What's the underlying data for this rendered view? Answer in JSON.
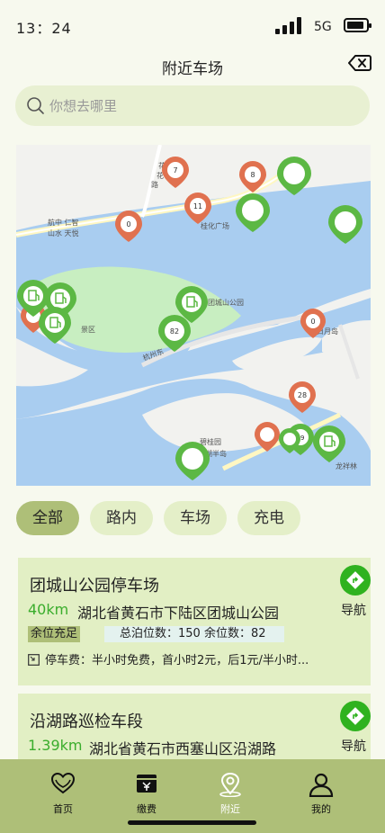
{
  "status_bar": {
    "time": "13：24",
    "network": "5G"
  },
  "header": {
    "title": "附近车场"
  },
  "search": {
    "placeholder": "你想去哪里"
  },
  "map": {
    "labels": [
      "航中 仁智",
      "山水 天悦",
      "桂化广场",
      "景区",
      "团城山公园",
      "杭州东",
      "碧桂园",
      "湖半岛",
      "日月岛",
      "龙祥林",
      "路",
      "花",
      "花"
    ],
    "marker_counts": [
      "7",
      "8",
      "11",
      "0",
      "0",
      "82",
      "28",
      "99"
    ]
  },
  "filters": [
    "全部",
    "路内",
    "车场",
    "充电"
  ],
  "active_filter": "全部",
  "lots": [
    {
      "name": "团城山公园停车场",
      "distance": "40km",
      "address": "湖北省黄石市下陆区团城山公园",
      "status": "余位充足",
      "stats": "总泊位数：150  余位数：82",
      "fee": "停车费：半小时免费，首小时2元，后1元/半小时..."
    },
    {
      "name": "沿湖路巡检车段",
      "distance": "1.39km",
      "address": "湖北省黄石市西塞山区沿湖路"
    }
  ],
  "nav_label": "导航",
  "tabs": [
    "首页",
    "缴费",
    "附近",
    "我的"
  ],
  "current_tab": "附近",
  "colors": {
    "accent": "#aebf78",
    "chip": "#e4efc8",
    "card": "#e2efc4",
    "green_marker": "#5cb844",
    "red_marker": "#e0714f",
    "water": "#a9cdf0",
    "park": "#c8eec1",
    "distance": "#3aad2c",
    "nav_button": "#2fb21f"
  }
}
